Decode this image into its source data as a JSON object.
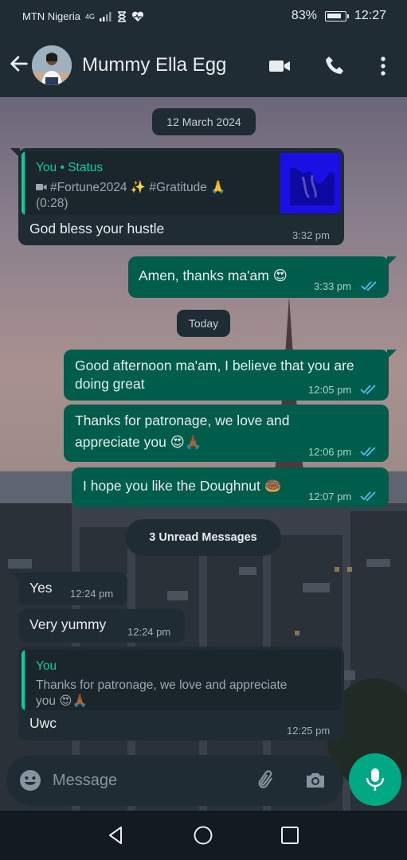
{
  "status_bar": {
    "carrier": "MTN Nigeria",
    "network": "4G",
    "battery": "83%",
    "battery_fraction": 0.83,
    "time": "12:27"
  },
  "header": {
    "contact_name": "Mummy Ella Egg",
    "icons": [
      "back-arrow-icon",
      "video-call-icon",
      "voice-call-icon",
      "more-options-icon"
    ]
  },
  "chat": {
    "date_separator_1": "12 March 2024",
    "status_reply": {
      "author": "You • Status",
      "caption": "#Fortune2024 ✨ #Gratitude 🙏",
      "duration": "(0:28)",
      "text": "God bless your hustle",
      "time": "3:32 pm"
    },
    "out_1": {
      "text": "Amen, thanks ma'am 😍",
      "time": "3:33 pm"
    },
    "date_separator_2": "Today",
    "out_2": {
      "line1": "Good afternoon ma'am, I believe that you are",
      "line2": "doing great",
      "time": "12:05 pm"
    },
    "out_3": {
      "line1": "Thanks for patronage, we love  and",
      "line2": "appreciate you 😍🙏🏾",
      "time": "12:06 pm"
    },
    "out_4": {
      "text": "I hope you like the Doughnut 🍩",
      "time": "12:07 pm"
    },
    "unread_label": "3 Unread Messages",
    "in_1": {
      "text": "Yes",
      "time": "12:24 pm"
    },
    "in_2": {
      "text": "Very yummy",
      "time": "12:24 pm"
    },
    "reply": {
      "quote_author": "You",
      "quote_line1": "Thanks for patronage, we love  and appreciate",
      "quote_line2": "you 😍🙏🏾",
      "text": "Uwc",
      "time": "12:25 pm"
    }
  },
  "composer": {
    "placeholder": "Message",
    "icons": [
      "emoji-icon",
      "attach-icon",
      "camera-icon",
      "mic-icon"
    ]
  },
  "nav_bar": {
    "icons": [
      "nav-back-icon",
      "nav-home-icon",
      "nav-recents-icon"
    ]
  },
  "colors": {
    "outgoing_bubble": "#005c4b",
    "incoming_bubble": "#1f2c34",
    "accent": "#00a884",
    "read_ticks": "#53bdeb"
  }
}
